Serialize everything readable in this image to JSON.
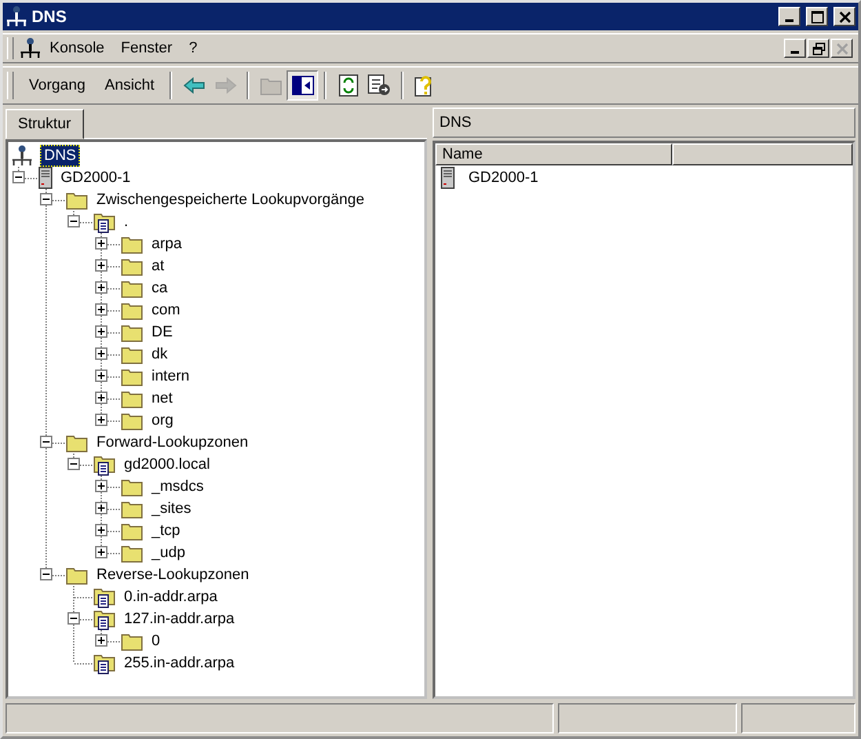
{
  "window": {
    "title": "DNS",
    "controls": [
      {
        "kind": "minimize",
        "disabled": false
      },
      {
        "kind": "maximize",
        "disabled": false
      },
      {
        "kind": "close",
        "disabled": false
      }
    ]
  },
  "menu": {
    "items": [
      {
        "label": "Konsole"
      },
      {
        "label": "Fenster"
      },
      {
        "label": "?"
      }
    ],
    "child_controls": [
      {
        "kind": "minimize",
        "disabled": false
      },
      {
        "kind": "restore",
        "disabled": false
      },
      {
        "kind": "close",
        "disabled": true
      }
    ]
  },
  "toolbar": {
    "menus": [
      {
        "label": "Vorgang"
      },
      {
        "label": "Ansicht"
      }
    ],
    "buttons": [
      {
        "kind": "back",
        "disabled": false,
        "pressed": false
      },
      {
        "kind": "forward",
        "disabled": true,
        "pressed": false
      },
      {
        "kind": "up",
        "disabled": true,
        "pressed": false
      },
      {
        "kind": "tree",
        "disabled": false,
        "pressed": true
      },
      {
        "kind": "refresh",
        "disabled": false,
        "pressed": false
      },
      {
        "kind": "export",
        "disabled": false,
        "pressed": false
      },
      {
        "kind": "help",
        "disabled": false,
        "pressed": false
      }
    ]
  },
  "tree_pane": {
    "tab": {
      "label": "Struktur",
      "selected": true
    },
    "root": {
      "label": "DNS",
      "selected": true
    },
    "nodes": [
      {
        "label": "GD2000-1",
        "kind": "server",
        "has_children": true,
        "expanded": true,
        "selected": false,
        "children": [
          {
            "label": "Zwischengespeicherte Lookupvorgänge",
            "kind": "folder",
            "has_children": true,
            "expanded": true,
            "selected": false,
            "children": [
              {
                "label": ".",
                "kind": "zone",
                "has_children": true,
                "expanded": true,
                "selected": false,
                "children": [
                  {
                    "label": "arpa",
                    "kind": "folder",
                    "has_children": true,
                    "expanded": false,
                    "selected": false
                  },
                  {
                    "label": "at",
                    "kind": "folder",
                    "has_children": true,
                    "expanded": false,
                    "selected": false
                  },
                  {
                    "label": "ca",
                    "kind": "folder",
                    "has_children": true,
                    "expanded": false,
                    "selected": false
                  },
                  {
                    "label": "com",
                    "kind": "folder",
                    "has_children": true,
                    "expanded": false,
                    "selected": false
                  },
                  {
                    "label": "DE",
                    "kind": "folder",
                    "has_children": true,
                    "expanded": false,
                    "selected": false
                  },
                  {
                    "label": "dk",
                    "kind": "folder",
                    "has_children": true,
                    "expanded": false,
                    "selected": false
                  },
                  {
                    "label": "intern",
                    "kind": "folder",
                    "has_children": true,
                    "expanded": false,
                    "selected": false
                  },
                  {
                    "label": "net",
                    "kind": "folder",
                    "has_children": true,
                    "expanded": false,
                    "selected": false
                  },
                  {
                    "label": "org",
                    "kind": "folder",
                    "has_children": true,
                    "expanded": false,
                    "selected": false
                  }
                ]
              }
            ]
          },
          {
            "label": "Forward-Lookupzonen",
            "kind": "folder",
            "has_children": true,
            "expanded": true,
            "selected": false,
            "children": [
              {
                "label": "gd2000.local",
                "kind": "zone",
                "has_children": true,
                "expanded": true,
                "selected": false,
                "children": [
                  {
                    "label": "_msdcs",
                    "kind": "folder",
                    "has_children": true,
                    "expanded": false,
                    "selected": false
                  },
                  {
                    "label": "_sites",
                    "kind": "folder",
                    "has_children": true,
                    "expanded": false,
                    "selected": false
                  },
                  {
                    "label": "_tcp",
                    "kind": "folder",
                    "has_children": true,
                    "expanded": false,
                    "selected": false
                  },
                  {
                    "label": "_udp",
                    "kind": "folder",
                    "has_children": true,
                    "expanded": false,
                    "selected": false
                  }
                ]
              }
            ]
          },
          {
            "label": "Reverse-Lookupzonen",
            "kind": "folder",
            "has_children": true,
            "expanded": true,
            "selected": false,
            "children": [
              {
                "label": "0.in-addr.arpa",
                "kind": "zone",
                "has_children": false,
                "selected": false
              },
              {
                "label": "127.in-addr.arpa",
                "kind": "zone",
                "has_children": true,
                "expanded": true,
                "selected": false,
                "children": [
                  {
                    "label": "0",
                    "kind": "folder",
                    "has_children": true,
                    "expanded": false,
                    "selected": false
                  }
                ]
              },
              {
                "label": "255.in-addr.arpa",
                "kind": "zone",
                "has_children": false,
                "selected": false
              }
            ]
          }
        ]
      }
    ]
  },
  "detail_pane": {
    "title": "DNS",
    "columns": [
      {
        "label": "Name"
      }
    ],
    "rows": [
      {
        "name": "GD2000-1",
        "kind": "server"
      }
    ]
  }
}
